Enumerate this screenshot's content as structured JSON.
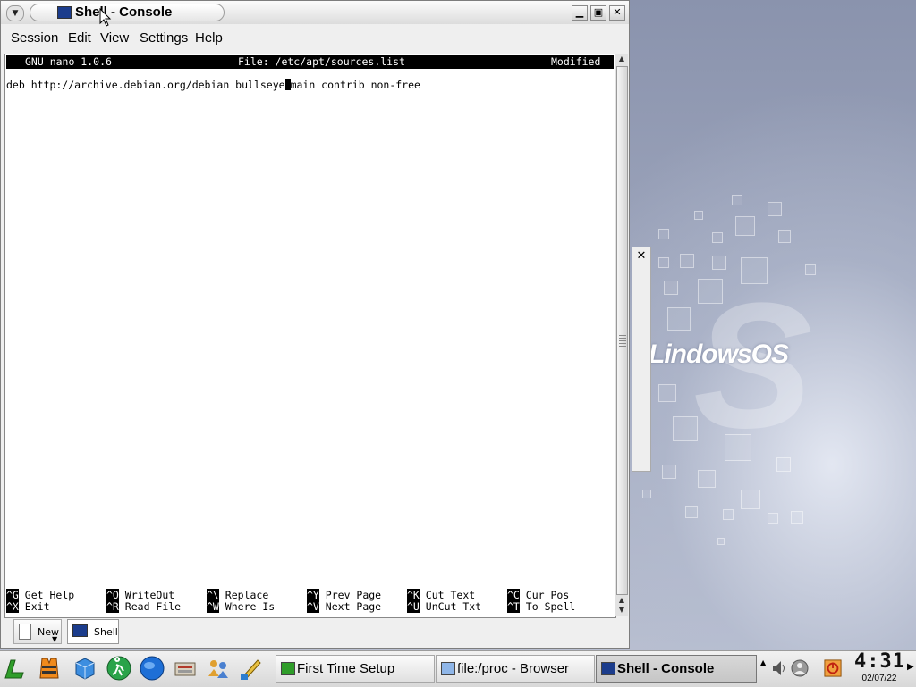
{
  "desktop": {
    "logo_text": "LindowsOS"
  },
  "window": {
    "title": "Shell - Console",
    "menu": [
      "Session",
      "Edit",
      "View",
      "Settings",
      "Help"
    ]
  },
  "nano": {
    "version": "GNU nano 1.0.6",
    "file": "File: /etc/apt/sources.list",
    "status": "Modified",
    "line_before_cursor": "deb http://archive.debian.org/debian bullseye",
    "line_after_cursor": "main contrib non-free",
    "shortcuts": [
      {
        "key": "^G",
        "label": "Get Help"
      },
      {
        "key": "^O",
        "label": "WriteOut"
      },
      {
        "key": "^\\",
        "label": "Replace"
      },
      {
        "key": "^Y",
        "label": "Prev Page"
      },
      {
        "key": "^K",
        "label": "Cut Text"
      },
      {
        "key": "^C",
        "label": "Cur Pos"
      },
      {
        "key": "^X",
        "label": "Exit"
      },
      {
        "key": "^R",
        "label": "Read File"
      },
      {
        "key": "^W",
        "label": "Where Is"
      },
      {
        "key": "^V",
        "label": "Next Page"
      },
      {
        "key": "^U",
        "label": "UnCut Txt"
      },
      {
        "key": "^T",
        "label": "To Spell"
      }
    ]
  },
  "session_bar": {
    "new_label": "New",
    "tab_label": "Shell"
  },
  "taskbar": {
    "tasks": [
      {
        "label": "First Time Setup",
        "icon": "setup-icon"
      },
      {
        "label": "file:/proc - Browser",
        "icon": "folder-icon"
      },
      {
        "label": "Shell - Console",
        "icon": "console-icon"
      }
    ],
    "clock_time": "4:31",
    "clock_date": "02/07/22"
  },
  "colors": {
    "terminal_bg": "#ffffff",
    "header_bg": "#000000",
    "console_icon": "#1b3c8c"
  }
}
